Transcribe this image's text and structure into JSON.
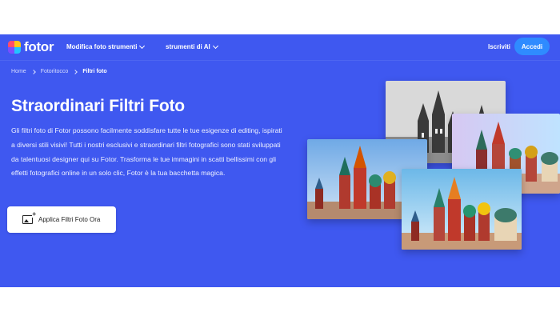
{
  "header": {
    "logo_text": "fotor",
    "nav": [
      {
        "label": "Modifica foto strumenti"
      },
      {
        "label": "strumenti di AI"
      }
    ],
    "signup_label": "Iscriviti",
    "login_label": "Accedi"
  },
  "breadcrumb": [
    "Home",
    "Fotoritocco",
    "Filtri foto"
  ],
  "hero": {
    "title": "Straordinari Filtri Foto",
    "description": "Gli filtri foto di Fotor possono facilmente soddisfare tutte le tue esigenze di editing, ispirati a diversi stili visivi! Tutti i nostri esclusivi e straordinari filtri fotografici sono stati sviluppati da talentuosi designer qui su Fotor. Trasforma le tue immagini in scatti bellissimi con gli effetti fotografici online in un solo clic, Fotor è la tua bacchetta magica.",
    "cta_label": "Applica Filtri Foto Ora"
  },
  "icons": {
    "logo": "fotor-logo-icon",
    "cta": "add-image-icon",
    "dropdown": "chevron-down-icon"
  },
  "colors": {
    "page_bg": "#3f58f0",
    "login_button": "#2f8bff"
  }
}
